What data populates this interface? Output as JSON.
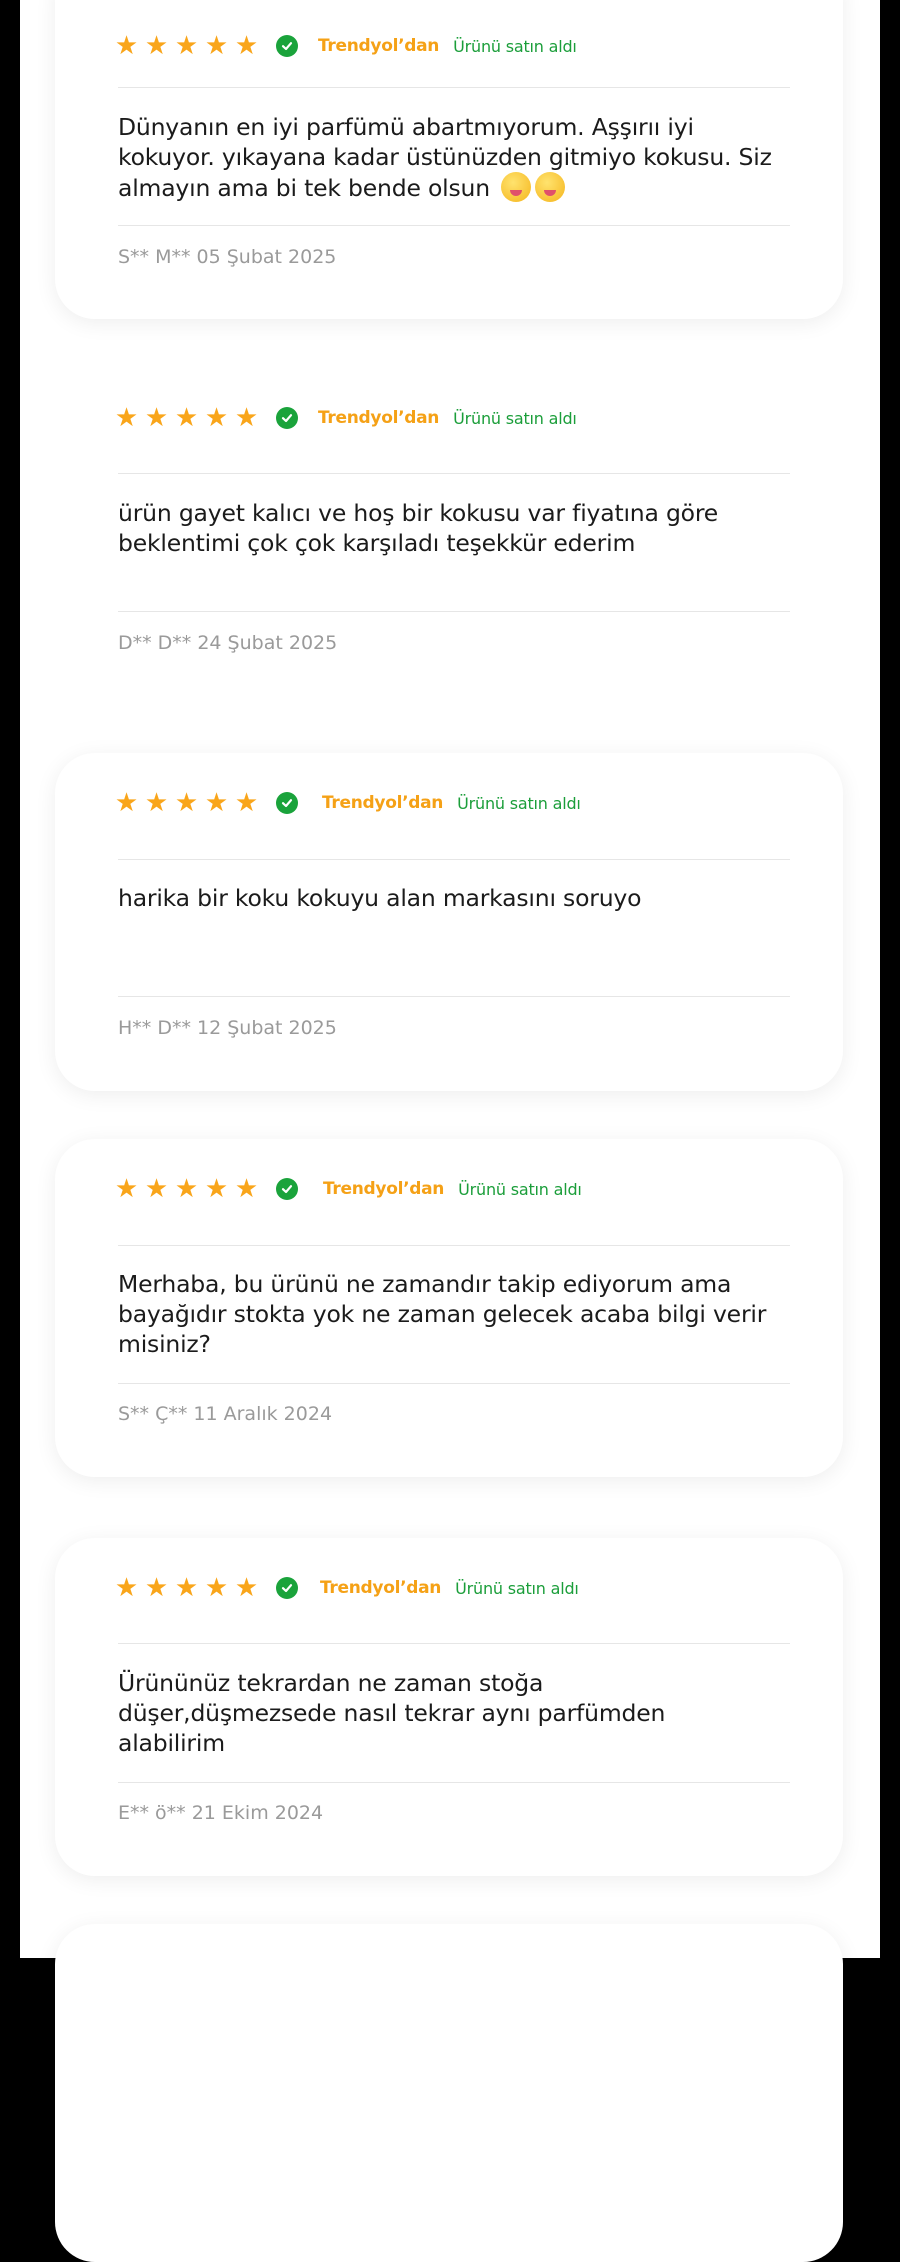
{
  "colors": {
    "star": "#f9a51a",
    "source": "#f5a116",
    "verified": "#1aa33b",
    "bought": "#1b9e3a"
  },
  "icons": {
    "star": "star-icon",
    "verified": "check-circle-icon",
    "emoji": "zany-face-emoji"
  },
  "reviews": [
    {
      "rating": 5,
      "source": "Trendyol’dan",
      "purchase": "Ürünü satın aldı",
      "text": "Dünyanın en iyi parfümü abartmıyorum. Aşşırıı iyi kokuyor. yıkayana kadar üstünüzden gitmiyo kokusu. Siz almayın ama bi tek bende olsun",
      "author": "S** M**  05 Şubat 2025"
    },
    {
      "rating": 5,
      "source": "Trendyol’dan",
      "purchase": "Ürünü satın aldı",
      "text": "ürün gayet kalıcı ve hoş bir kokusu var fiyatına göre beklentimi çok çok karşıladı teşekkür ederim",
      "author": "D** D** 24 Şubat 2025"
    },
    {
      "rating": 5,
      "source": "Trendyol’dan",
      "purchase": "Ürünü satın aldı",
      "text": "harika bir koku kokuyu alan markasını soruyo",
      "author": "H** D**  12 Şubat 2025"
    },
    {
      "rating": 5,
      "source": "Trendyol’dan",
      "purchase": "Ürünü satın aldı",
      "text": "Merhaba, bu ürünü ne zamandır takip ediyorum ama bayağıdır stokta yok ne zaman gelecek acaba bilgi verir misiniz?",
      "author": "S** Ç** 11 Aralık 2024"
    },
    {
      "rating": 5,
      "source": "Trendyol’dan",
      "purchase": "Ürünü satın aldı",
      "text": "Ürününüz tekrardan ne zaman stoğa düşer,düşmezsede nasıl tekrar aynı parfümden alabilirim",
      "author": "E** ö**   21 Ekim 2024"
    }
  ]
}
